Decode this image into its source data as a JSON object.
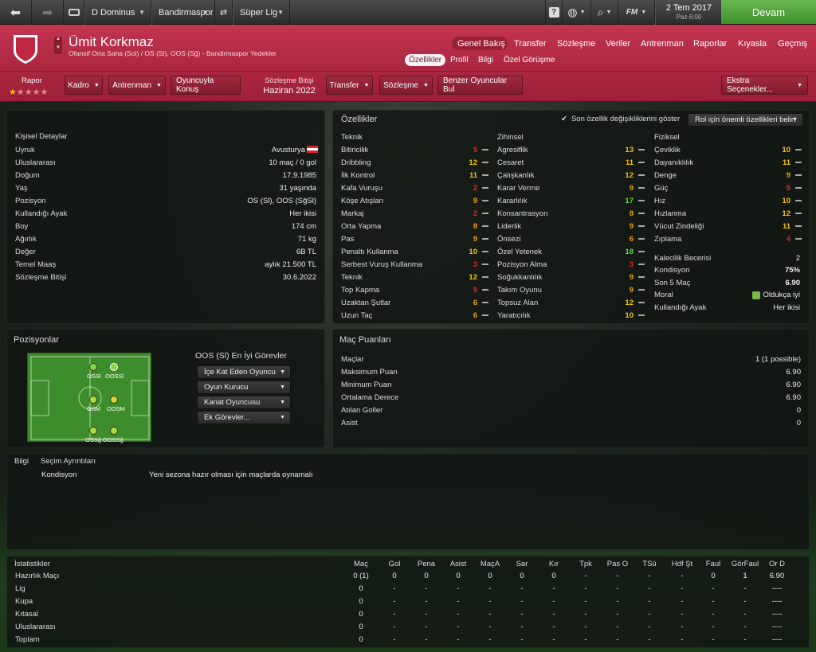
{
  "topbar": {
    "club_dropdown": "D Dominus",
    "team_dropdown": "Bandirmaspor",
    "league_dropdown": "Süper Lig",
    "date": "2 Tem 2017",
    "day_time": "Paz 6:00",
    "fm_label": "FM",
    "continue_label": "Devam"
  },
  "player": {
    "name": "Ümit Korkmaz",
    "subtitle": "Ofansif Orta Saha (Sol) / OS (Sl), OOS (Sğ) - Bandirmaspor Yedekler"
  },
  "nav": {
    "main": [
      "Genel Bakış",
      "Transfer",
      "Sözleşme",
      "Veriler",
      "Antrenman",
      "Raporlar",
      "Kıyasla",
      "Geçmiş"
    ],
    "sub": [
      "Özellikler",
      "Profil",
      "Bilgi",
      "Özel Görüşme"
    ]
  },
  "actions": {
    "report_label": "Rapor",
    "kadro": "Kadro",
    "antrenman": "Antrenman",
    "konus": "Oyuncuyla Konuş",
    "contract_label": "Sözleşme Bitişi",
    "contract_value": "Haziran 2022",
    "transfer": "Transfer",
    "sozlesme": "Sözleşme",
    "benzer": "Benzer Oyuncular Bul",
    "ekstra": "Ekstra Seçenekler...",
    "rating_stars": 1,
    "max_stars": 5
  },
  "personal": {
    "title": "Kişisel Detaylar",
    "rows": [
      [
        "Uyruk",
        "Avusturya"
      ],
      [
        "Uluslararası",
        "10 maç / 0 gol"
      ],
      [
        "Doğum",
        "17.9.1985"
      ],
      [
        "Yaş",
        "31 yaşında"
      ],
      [
        "Pozisyon",
        "OS (Sl), OOS (SğSl)"
      ],
      [
        "Kullandığı Ayak",
        "Her ikisi"
      ],
      [
        "Boy",
        "174 cm"
      ],
      [
        "Ağırlık",
        "71 kg"
      ],
      [
        "Değer",
        "6B TL"
      ],
      [
        "Temel Maaş",
        "aylık 21.500 TL"
      ],
      [
        "Sözleşme Bitişi",
        "30.6.2022"
      ]
    ]
  },
  "attributes": {
    "title": "Özellikler",
    "toggle_label": "Son özellik değişikliklerini göster",
    "role_dropdown": "Rol için önemli özellikleri belirt",
    "technical_title": "Teknik",
    "technical": [
      [
        "Bitiricilik",
        "5",
        "r"
      ],
      [
        "Dribbling",
        "12",
        "y"
      ],
      [
        "İlk Kontrol",
        "11",
        "y"
      ],
      [
        "Kafa Vuruşu",
        "2",
        "r"
      ],
      [
        "Köşe Atışları",
        "9",
        "o"
      ],
      [
        "Markaj",
        "2",
        "r"
      ],
      [
        "Orta Yapma",
        "8",
        "o"
      ],
      [
        "Pas",
        "9",
        "o"
      ],
      [
        "Penaltı Kullanma",
        "10",
        "y"
      ],
      [
        "Serbest Vuruş Kullanma",
        "3",
        "r"
      ],
      [
        "Teknik",
        "12",
        "y"
      ],
      [
        "Top Kapma",
        "5",
        "r"
      ],
      [
        "Uzaktan Şutlar",
        "6",
        "o"
      ],
      [
        "Uzun Taç",
        "6",
        "o"
      ]
    ],
    "mental_title": "Zihinsel",
    "mental": [
      [
        "Agresiflik",
        "13",
        "y"
      ],
      [
        "Cesaret",
        "11",
        "y"
      ],
      [
        "Çalışkanlık",
        "12",
        "y"
      ],
      [
        "Karar Verme",
        "9",
        "o"
      ],
      [
        "Kararlılık",
        "17",
        "g"
      ],
      [
        "Konsantrasyon",
        "8",
        "o"
      ],
      [
        "Liderlik",
        "9",
        "o"
      ],
      [
        "Önsezi",
        "6",
        "o"
      ],
      [
        "Özel Yetenek",
        "18",
        "g"
      ],
      [
        "Pozisyon Alma",
        "3",
        "r"
      ],
      [
        "Soğukkanlılık",
        "9",
        "o"
      ],
      [
        "Takım Oyunu",
        "9",
        "o"
      ],
      [
        "Topsuz Alan",
        "12",
        "y"
      ],
      [
        "Yaratıcılık",
        "10",
        "y"
      ]
    ],
    "physical_title": "Fiziksel",
    "physical": [
      [
        "Çeviklik",
        "10",
        "y"
      ],
      [
        "Dayanıklılık",
        "11",
        "y"
      ],
      [
        "Denge",
        "9",
        "o"
      ],
      [
        "Güç",
        "5",
        "r"
      ],
      [
        "Hız",
        "10",
        "y"
      ],
      [
        "Hızlanma",
        "12",
        "y"
      ],
      [
        "Vücut Zindeliği",
        "11",
        "y"
      ],
      [
        "Zıplama",
        "4",
        "r"
      ]
    ],
    "extra": [
      [
        "Kalecilik Becerisi",
        "2"
      ],
      [
        "Kondisyon",
        "75%"
      ],
      [
        "Son 5 Maç",
        "6.90"
      ],
      [
        "Moral",
        "Oldukça iyi"
      ],
      [
        "Kullandığı Ayak",
        "Her ikisi"
      ]
    ]
  },
  "positions": {
    "title": "Pozisyonlar",
    "roles_title": "OOS (Sl) En İyi Görevler",
    "roles": [
      "İçe Kat Eden Oyuncu",
      "Oyun Kurucu",
      "Kanat Oyuncusu",
      "Ek Görevler..."
    ],
    "labels": [
      "OSSl",
      "OOSSl",
      "OSM",
      "OOSM",
      "OSSğ",
      "OOSSğ"
    ]
  },
  "ratings": {
    "title": "Maç Puanları",
    "rows": [
      [
        "Maçlar",
        "1 (1 possible)"
      ],
      [
        "Maksimum Puan",
        "6.90"
      ],
      [
        "Minimum Puan",
        "6.90"
      ],
      [
        "Ortalama Derece",
        "6.90"
      ],
      [
        "Atılan Goller",
        "0"
      ],
      [
        "Asist",
        "0"
      ]
    ]
  },
  "info": {
    "tab1": "Bilgi",
    "tab2": "Seçim Ayrıntıları",
    "label": "Kondisyon",
    "text": "Yeni sezona hazır olması için maçlarda oynamalı"
  },
  "stats": {
    "title": "İstatistikler",
    "headers": [
      "Maç",
      "Gol",
      "Pena",
      "Asist",
      "MaçA",
      "Sar",
      "Kır",
      "Tpk",
      "Pas O",
      "TSü",
      "Hdf Şt",
      "Faul",
      "GörFaul",
      "Or D"
    ],
    "rows": [
      [
        "Hazırlık Maçı",
        "0 (1)",
        "0",
        "0",
        "0",
        "0",
        "0",
        "0",
        "-",
        "-",
        "-",
        "-",
        "0",
        "1",
        "6.90"
      ],
      [
        "Lig",
        "0",
        "-",
        "-",
        "-",
        "-",
        "-",
        "-",
        "-",
        "-",
        "-",
        "-",
        "-",
        "-",
        "----"
      ],
      [
        "Kupa",
        "0",
        "-",
        "-",
        "-",
        "-",
        "-",
        "-",
        "-",
        "-",
        "-",
        "-",
        "-",
        "-",
        "----"
      ],
      [
        "Kıtasal",
        "0",
        "-",
        "-",
        "-",
        "-",
        "-",
        "-",
        "-",
        "-",
        "-",
        "-",
        "-",
        "-",
        "----"
      ],
      [
        "Uluslararası",
        "0",
        "-",
        "-",
        "-",
        "-",
        "-",
        "-",
        "-",
        "-",
        "-",
        "-",
        "-",
        "-",
        "----"
      ],
      [
        "Toplam",
        "0",
        "-",
        "-",
        "-",
        "-",
        "-",
        "-",
        "-",
        "-",
        "-",
        "-",
        "-",
        "-",
        "----"
      ]
    ]
  }
}
